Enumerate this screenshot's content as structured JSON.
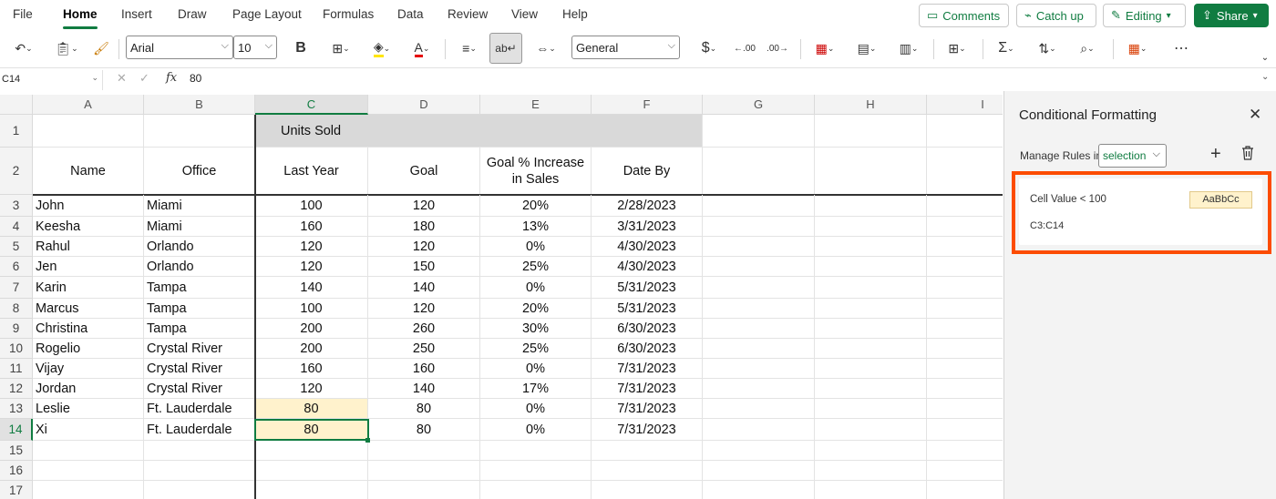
{
  "menu": [
    "File",
    "Home",
    "Insert",
    "Draw",
    "Page Layout",
    "Formulas",
    "Data",
    "Review",
    "View",
    "Help"
  ],
  "active_menu": "Home",
  "actions": {
    "comments": "Comments",
    "catch_up": "Catch up",
    "editing": "Editing",
    "share": "Share"
  },
  "toolbar": {
    "font_name": "Arial",
    "font_size": "10",
    "bold": "B",
    "number_format": "General",
    "currency": "$"
  },
  "formula_bar": {
    "name_box": "C14",
    "fx": "fx",
    "value": "80"
  },
  "columns": [
    "A",
    "B",
    "C",
    "D",
    "E",
    "F",
    "G",
    "H",
    "I"
  ],
  "rows": [
    "1",
    "2",
    "3",
    "4",
    "5",
    "6",
    "7",
    "8",
    "9",
    "10",
    "11",
    "12",
    "13",
    "14",
    "15",
    "16",
    "17"
  ],
  "header": {
    "units_sold": "Units Sold",
    "name": "Name",
    "office": "Office",
    "last_year": "Last Year",
    "goal": "Goal",
    "increase": "Goal % Increase in Sales",
    "date_by": "Date By"
  },
  "table": [
    [
      "John",
      "Miami",
      "100",
      "120",
      "20%",
      "2/28/2023"
    ],
    [
      "Keesha",
      "Miami",
      "160",
      "180",
      "13%",
      "3/31/2023"
    ],
    [
      "Rahul",
      "Orlando",
      "120",
      "120",
      "0%",
      "4/30/2023"
    ],
    [
      "Jen",
      "Orlando",
      "120",
      "150",
      "25%",
      "4/30/2023"
    ],
    [
      "Karin",
      "Tampa",
      "140",
      "140",
      "0%",
      "5/31/2023"
    ],
    [
      "Marcus",
      "Tampa",
      "100",
      "120",
      "20%",
      "5/31/2023"
    ],
    [
      "Christina",
      "Tampa",
      "200",
      "260",
      "30%",
      "6/30/2023"
    ],
    [
      "Rogelio",
      "Crystal River",
      "200",
      "250",
      "25%",
      "6/30/2023"
    ],
    [
      "Vijay",
      "Crystal River",
      "160",
      "160",
      "0%",
      "7/31/2023"
    ],
    [
      "Jordan",
      "Crystal River",
      "120",
      "140",
      "17%",
      "7/31/2023"
    ],
    [
      "Leslie",
      "Ft. Lauderdale",
      "80",
      "80",
      "0%",
      "7/31/2023"
    ],
    [
      "Xi",
      "Ft. Lauderdale",
      "80",
      "80",
      "0%",
      "7/31/2023"
    ]
  ],
  "panel": {
    "title": "Conditional Formatting",
    "manage_label": "Manage Rules in",
    "manage_value": "selection",
    "rule_condition": "Cell Value < 100",
    "rule_preview": "AaBbCc",
    "rule_range": "C3:C14"
  },
  "colors": {
    "accent": "#107c41",
    "highlight": "#fff2cc",
    "callout": "#fc4c02",
    "header_fill": "#d9d9d9"
  }
}
